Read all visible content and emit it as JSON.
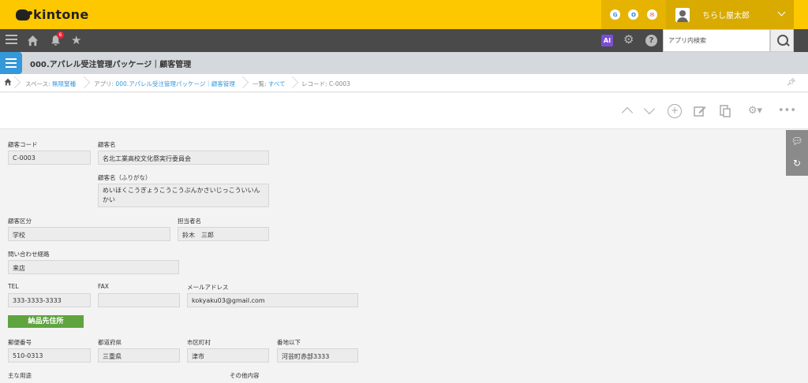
{
  "header": {
    "brand": "kintone",
    "services": [
      {
        "icon": "google-icon",
        "glyph": "G",
        "color": "#4285f4"
      },
      {
        "icon": "garoon-icon",
        "glyph": "O",
        "color": "#1a8bd8"
      },
      {
        "icon": "mail-icon",
        "glyph": "✉",
        "color": "#e53935"
      }
    ],
    "user_name": "ちらし屋太郎"
  },
  "nav": {
    "notification_count": "6",
    "ai_label": "AI",
    "help_label": "?",
    "search_placeholder": "アプリ内検索"
  },
  "app": {
    "title": "000.アパレル受注管理パッケージ｜顧客管理"
  },
  "breadcrumb": {
    "space_prefix": "スペース: ",
    "space_name": "無限窒種",
    "app_prefix": "アプリ: ",
    "app_name": "000.アパレル受注管理パッケージ｜顧客管理",
    "list_prefix": "一覧: ",
    "list_name": "すべて",
    "record": "レコード: C-0003"
  },
  "form": {
    "customer_code": {
      "label": "顧客コード",
      "value": "C-0003"
    },
    "customer_name": {
      "label": "顧客名",
      "value": "名北工業高校文化祭実行委員会"
    },
    "customer_kana": {
      "label": "顧客名（ふりがな）",
      "value": "めいほくこうぎょうこうこうぶんかさいじっこういいんかい"
    },
    "customer_type": {
      "label": "顧客区分",
      "value": "学校"
    },
    "staff_name": {
      "label": "担当者名",
      "value": "鈴木　三郎"
    },
    "inquiry_route": {
      "label": "問い合わせ経路",
      "value": "来店"
    },
    "tel": {
      "label": "TEL",
      "value": "333-3333-3333"
    },
    "fax": {
      "label": "FAX",
      "value": ""
    },
    "email": {
      "label": "メールアドレス",
      "value": "kokyaku03@gmail.com"
    },
    "delivery_group": "納品先住所",
    "zip": {
      "label": "郵便番号",
      "value": "510-0313"
    },
    "prefecture": {
      "label": "都道府県",
      "value": "三重県"
    },
    "city": {
      "label": "市区町村",
      "value": "津市"
    },
    "address": {
      "label": "番地以下",
      "value": "河芸町赤部3333"
    },
    "main_use": {
      "label": "主な用途"
    },
    "other": {
      "label": "その他内容"
    }
  }
}
